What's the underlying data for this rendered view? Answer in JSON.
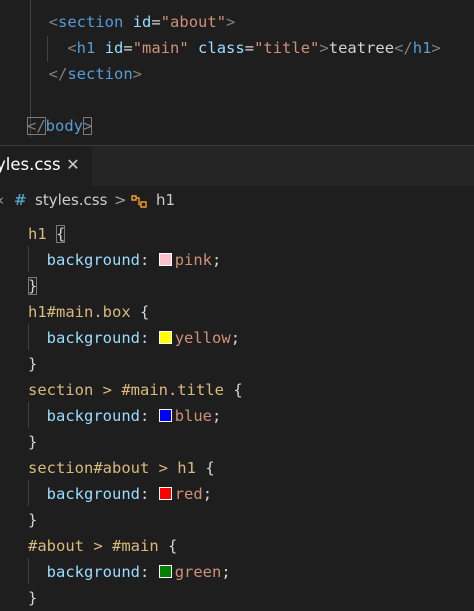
{
  "html_editor": {
    "lines": [
      {
        "indent": "  ",
        "t1": "<",
        "tag": "section",
        "attr": "id",
        "eq": "=",
        "str": "\"about\"",
        "t2": ">"
      },
      {
        "indent": "    ",
        "t1": "<",
        "tag": "h1",
        "attr1": "id",
        "eq1": "=",
        "str1": "\"main\"",
        "attr2": "class",
        "eq2": "=",
        "str2": "\"title\"",
        "t2": ">",
        "text": "teatree",
        "t3": "</",
        "tag2": "h1",
        "t4": ">"
      },
      {
        "indent": "  ",
        "t1": "</",
        "tag": "section",
        "t2": ">"
      },
      {
        "t1": "</",
        "tag": "body",
        "t2": ">"
      }
    ]
  },
  "tab": {
    "label": "yles.css",
    "close_glyph": "✕"
  },
  "breadcrumb": {
    "chevron_left": "‹",
    "hash": "#",
    "file": "styles.css",
    "separator": ">",
    "symbol_icon": "symbol-class-icon",
    "symbol": "h1"
  },
  "css_editor": {
    "rules": [
      {
        "selector": "h1",
        "open": "{",
        "property": "background",
        "colon": ":",
        "swatch_color": "#ffc0cb",
        "value": "pink",
        "semi": ";",
        "close": "}"
      },
      {
        "selector": "h1#main.box",
        "open": "{",
        "property": "background",
        "colon": ":",
        "swatch_color": "#ffff00",
        "value": "yellow",
        "semi": ";",
        "close": "}"
      },
      {
        "selector": "section > #main.title",
        "open": "{",
        "property": "background",
        "colon": ":",
        "swatch_color": "#0000ff",
        "value": "blue",
        "semi": ";",
        "close": "}"
      },
      {
        "selector": "section#about > h1",
        "open": "{",
        "property": "background",
        "colon": ":",
        "swatch_color": "#ff0000",
        "value": "red",
        "semi": ";",
        "close": "}"
      },
      {
        "selector": "#about > #main",
        "open": "{",
        "property": "background",
        "colon": ":",
        "swatch_color": "#008000",
        "value": "green",
        "semi": ";",
        "close": "}"
      }
    ]
  },
  "colors": {
    "editor_bg": "#1e1e1e",
    "tag": "#569cd6",
    "attribute": "#9cdcfe",
    "string": "#ce9178",
    "selector": "#d7ba7d"
  }
}
